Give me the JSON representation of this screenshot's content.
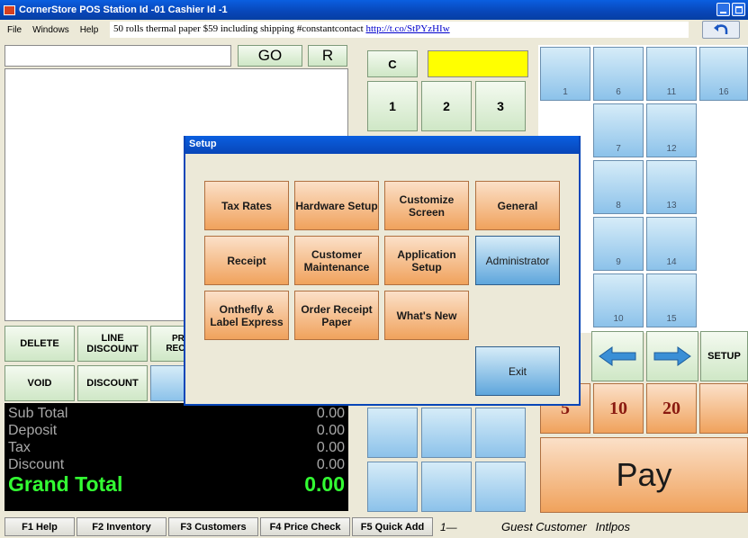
{
  "window": {
    "title": "CornerStore POS Station Id -01 Cashier Id -1"
  },
  "menu": {
    "items": [
      "File",
      "Windows",
      "Help"
    ]
  },
  "ticker": {
    "text": "50 rolls thermal paper $59 including shipping #constantcontact ",
    "link": "http://t.co/StPYzHIw"
  },
  "search": {
    "value": "",
    "go_label": "GO",
    "r_label": "R"
  },
  "keypad": {
    "c_label": "C",
    "display_value": "",
    "keys": [
      "1",
      "2",
      "3"
    ]
  },
  "quick_grid": {
    "labels": [
      "1",
      "6",
      "11",
      "16",
      "7",
      "12",
      "8",
      "13",
      "9",
      "14",
      "10",
      "15"
    ]
  },
  "actions": {
    "delete": "DELETE",
    "line_discount": "LINE DISCOUNT",
    "print_receipt": "PRINT RECEIPT",
    "void": "VOID",
    "discount": "DISCOUNT"
  },
  "cash_buttons": {
    "five": "5",
    "ten": "10",
    "twenty": "20",
    "setup": "SETUP",
    "pay": "Pay"
  },
  "totals": {
    "sub_total_label": "Sub Total",
    "sub_total": "0.00",
    "deposit_label": "Deposit",
    "deposit": "0.00",
    "tax_label": "Tax",
    "tax": "0.00",
    "discount_label": "Discount",
    "discount": "0.00",
    "grand_total_label": "Grand Total",
    "grand_total": "0.00"
  },
  "function_keys": [
    "F1 Help",
    "F2 Inventory",
    "F3 Customers",
    "F4 Price Check",
    "F5 Quick Add"
  ],
  "status": {
    "station": "1—",
    "customer": "Guest Customer",
    "user": "Intlpos"
  },
  "dialog": {
    "title": "Setup",
    "buttons": {
      "tax_rates": "Tax Rates",
      "hardware_setup": "Hardware Setup",
      "customize_screen": "Customize Screen",
      "general": "General",
      "receipt": "Receipt",
      "customer_maintenance": "Customer Maintenance",
      "application_setup": "Application Setup",
      "administrator": "Administrator",
      "onthefly": "Onthefly & Label Express",
      "order_receipt_paper": "Order Receipt Paper",
      "whats_new": "What's New",
      "exit": "Exit"
    }
  },
  "colors": {
    "brand_blue": "#0846b8",
    "total_bg": "#000000",
    "grand_total": "#33ff33",
    "orange": "#f0a25c",
    "green_btn": "#cfe7c6",
    "blue_btn": "#8cc2ea"
  }
}
